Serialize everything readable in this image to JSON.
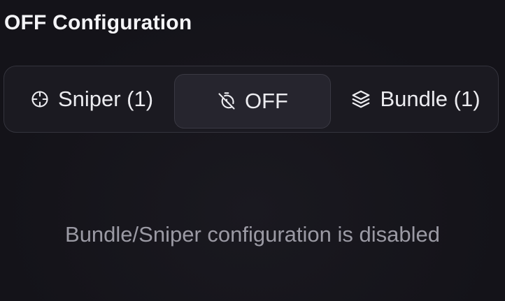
{
  "section": {
    "title": "OFF Configuration"
  },
  "modes": {
    "selected": "OFF",
    "items": [
      {
        "label": "Sniper (1)",
        "icon": "crosshair-icon"
      },
      {
        "label": "OFF",
        "icon": "timer-off-icon"
      },
      {
        "label": "Bundle (1)",
        "icon": "layers-icon"
      }
    ]
  },
  "empty_state": {
    "message": "Bundle/Sniper configuration is disabled"
  }
}
